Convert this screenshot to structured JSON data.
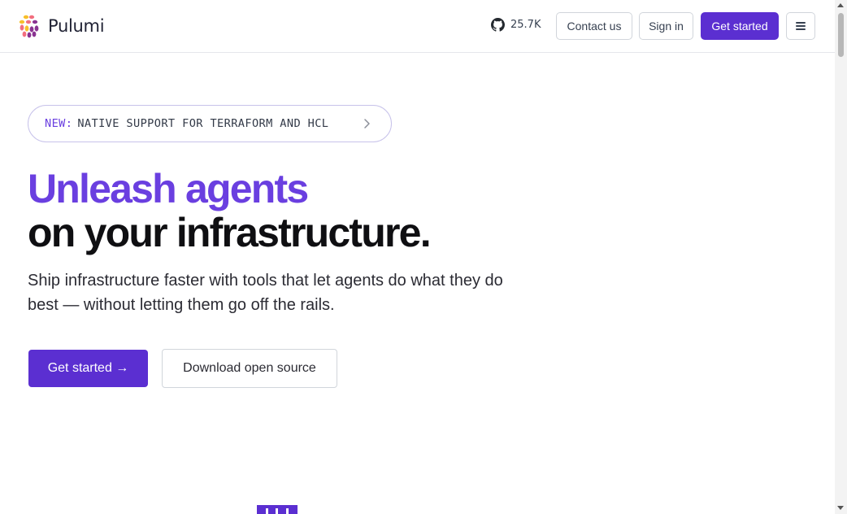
{
  "header": {
    "brand": "Pulumi",
    "github_stars": "25.7K",
    "contact_label": "Contact us",
    "signin_label": "Sign in",
    "get_started_label": "Get started",
    "menu_icon": "hamburger-menu-icon"
  },
  "announcement": {
    "tag": "NEW:",
    "text": "NATIVE SUPPORT FOR TERRAFORM AND HCL",
    "icon": "chevron-right-icon"
  },
  "hero": {
    "headline_accent": "Unleash agents",
    "headline_rest": "on your infrastructure.",
    "subheading": "Ship infrastructure faster with tools that let agents do what they do best — without letting them go off the rails.",
    "primary_cta": "Get started →",
    "secondary_cta": "Download open source"
  },
  "colors": {
    "accent": "#5b2fd1",
    "headline_accent": "#6a3fe0",
    "text": "#0f0f12"
  }
}
